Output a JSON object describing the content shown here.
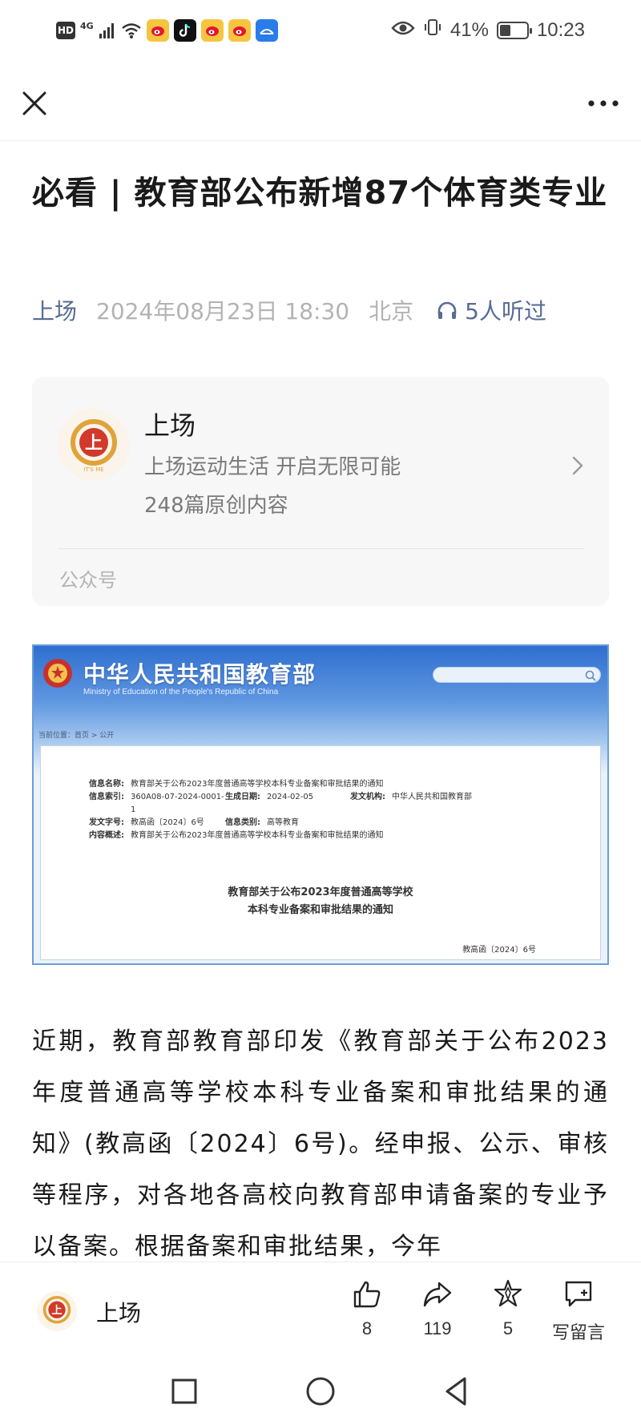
{
  "status_bar": {
    "hd": "HD",
    "network": "4G",
    "battery": "41%",
    "battery_level": 0.41,
    "time": "10:23"
  },
  "nav": {
    "close_icon": "close-icon",
    "more_icon": "more-icon"
  },
  "article": {
    "title": "必看 | 教育部公布新增87个体育类专业",
    "account": "上场",
    "date": "2024年08月23日 18:30",
    "location": "北京",
    "listened": "5人听过"
  },
  "account_card": {
    "name": "上场",
    "description": "上场运动生活 开启无限可能",
    "count": "248篇原创内容",
    "type": "公众号",
    "logo_text": "上",
    "logo_caption": "IT'S ME"
  },
  "doc_image": {
    "site_title": "中华人民共和国教育部",
    "site_subtitle": "Ministry of Education of the People's Republic of China",
    "breadcrumb": "当前位置：首页 > 公开",
    "info": {
      "name_label": "信息名称:",
      "name_value": "教育部关于公布2023年度普通高等学校本科专业备案和审批结果的通知",
      "index_label": "信息索引:",
      "index_value": "360A08-07-2024-0001-1",
      "date_label": "生成日期:",
      "date_value": "2024-02-05",
      "org_label": "发文机构:",
      "org_value": "中华人民共和国教育部",
      "doc_no_label": "发文字号:",
      "doc_no_value": "教高函〔2024〕6号",
      "category_label": "信息类别:",
      "category_value": "高等教育",
      "summary_label": "内容概述:",
      "summary_value": "教育部关于公布2023年度普通高等学校本科专业备案和审批结果的通知"
    },
    "heading_line1": "教育部关于公布2023年度普通高等学校",
    "heading_line2": "本科专业备案和审批结果的通知",
    "doc_number": "教高函〔2024〕6号"
  },
  "body": {
    "paragraph": "近期，教育部教育部印发《教育部关于公布2023年度普通高等学校本科专业备案和审批结果的通知》(教高函〔2024〕6号)。经申报、公示、审核等程序，对各地各高校向教育部申请备案的专业予以备案。根据备案和审批结果，今年"
  },
  "action_bar": {
    "account_name": "上场",
    "like_count": "8",
    "share_count": "119",
    "star_count": "5",
    "comment_label": "写留言"
  }
}
